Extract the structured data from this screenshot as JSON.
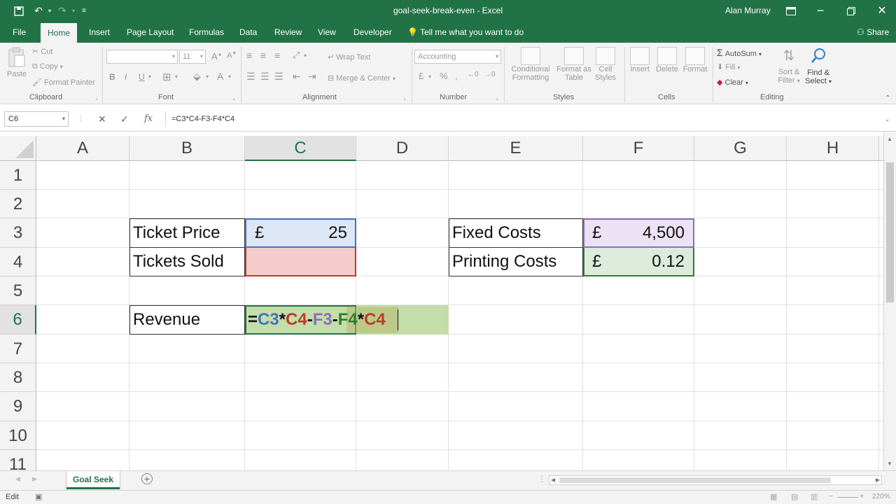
{
  "window": {
    "title": "goal-seek-break-even  -  Excel",
    "user": "Alan Murray",
    "share": "Share",
    "qat": {
      "undo": "↶",
      "redo": "↷"
    }
  },
  "ribbon_tabs": [
    "File",
    "Home",
    "Insert",
    "Page Layout",
    "Formulas",
    "Data",
    "Review",
    "View",
    "Developer"
  ],
  "tell_me": "Tell me what you want to do",
  "ribbon": {
    "clipboard": {
      "paste": "Paste",
      "cut": "Cut",
      "copy": "Copy",
      "format_painter": "Format Painter",
      "label": "Clipboard"
    },
    "font": {
      "font_name": "",
      "font_size": "11",
      "label": "Font",
      "bold": "B",
      "italic": "I",
      "underline": "U"
    },
    "alignment": {
      "wrap": "Wrap Text",
      "merge": "Merge & Center",
      "label": "Alignment"
    },
    "number": {
      "format": "Accounting",
      "label": "Number"
    },
    "styles": {
      "conditional": "Conditional",
      "conditional2": "Formatting",
      "format_as": "Format as",
      "format_as2": "Table",
      "cell": "Cell",
      "cell2": "Styles",
      "label": "Styles"
    },
    "cells": {
      "insert": "Insert",
      "delete": "Delete",
      "format": "Format",
      "label": "Cells"
    },
    "editing": {
      "autosum": "AutoSum",
      "fill": "Fill",
      "clear": "Clear",
      "sort": "Sort &",
      "sort2": "Filter",
      "find": "Find &",
      "find2": "Select",
      "label": "Editing"
    }
  },
  "formula_bar": {
    "name_box": "C6",
    "formula": "=C3*C4-F3-F4*C4",
    "fx": "fx"
  },
  "columns": [
    "A",
    "B",
    "C",
    "D",
    "E",
    "F",
    "G",
    "H"
  ],
  "rows": [
    "1",
    "2",
    "3",
    "4",
    "5",
    "6",
    "7",
    "8",
    "9",
    "10",
    "11"
  ],
  "cells": {
    "B3": "Ticket Price",
    "C3_symbol": "£",
    "C3_value": "25",
    "B4": "Tickets Sold",
    "E3": "Fixed Costs",
    "F3_symbol": "£",
    "F3_value": "4,500",
    "E4": "Printing Costs",
    "F4_symbol": "£",
    "F4_value": "0.12",
    "B6": "Revenue"
  },
  "edit_formula_parts": [
    {
      "text": "=",
      "color": "#111111"
    },
    {
      "text": "C3",
      "color": "#4472c4"
    },
    {
      "text": "*",
      "color": "#111111"
    },
    {
      "text": "C4",
      "color": "#c0392b"
    },
    {
      "text": "-",
      "color": "#111111"
    },
    {
      "text": "F3",
      "color": "#8e6bbf"
    },
    {
      "text": "-",
      "color": "#111111"
    },
    {
      "text": "F4",
      "color": "#2e7d32"
    },
    {
      "text": "*",
      "color": "#111111"
    },
    {
      "text": "C4",
      "color": "#c0392b"
    }
  ],
  "sheet_tabs": [
    "Goal Seek"
  ],
  "status": {
    "mode": "Edit",
    "zoom": "220%"
  },
  "colors": {
    "accent": "#217346",
    "ref_blue": "#dce6f4",
    "ref_red": "#f4cccc",
    "ref_purple": "#ebe3f3",
    "ref_green": "#dcebdc",
    "edit_green": "#c3dea8"
  }
}
